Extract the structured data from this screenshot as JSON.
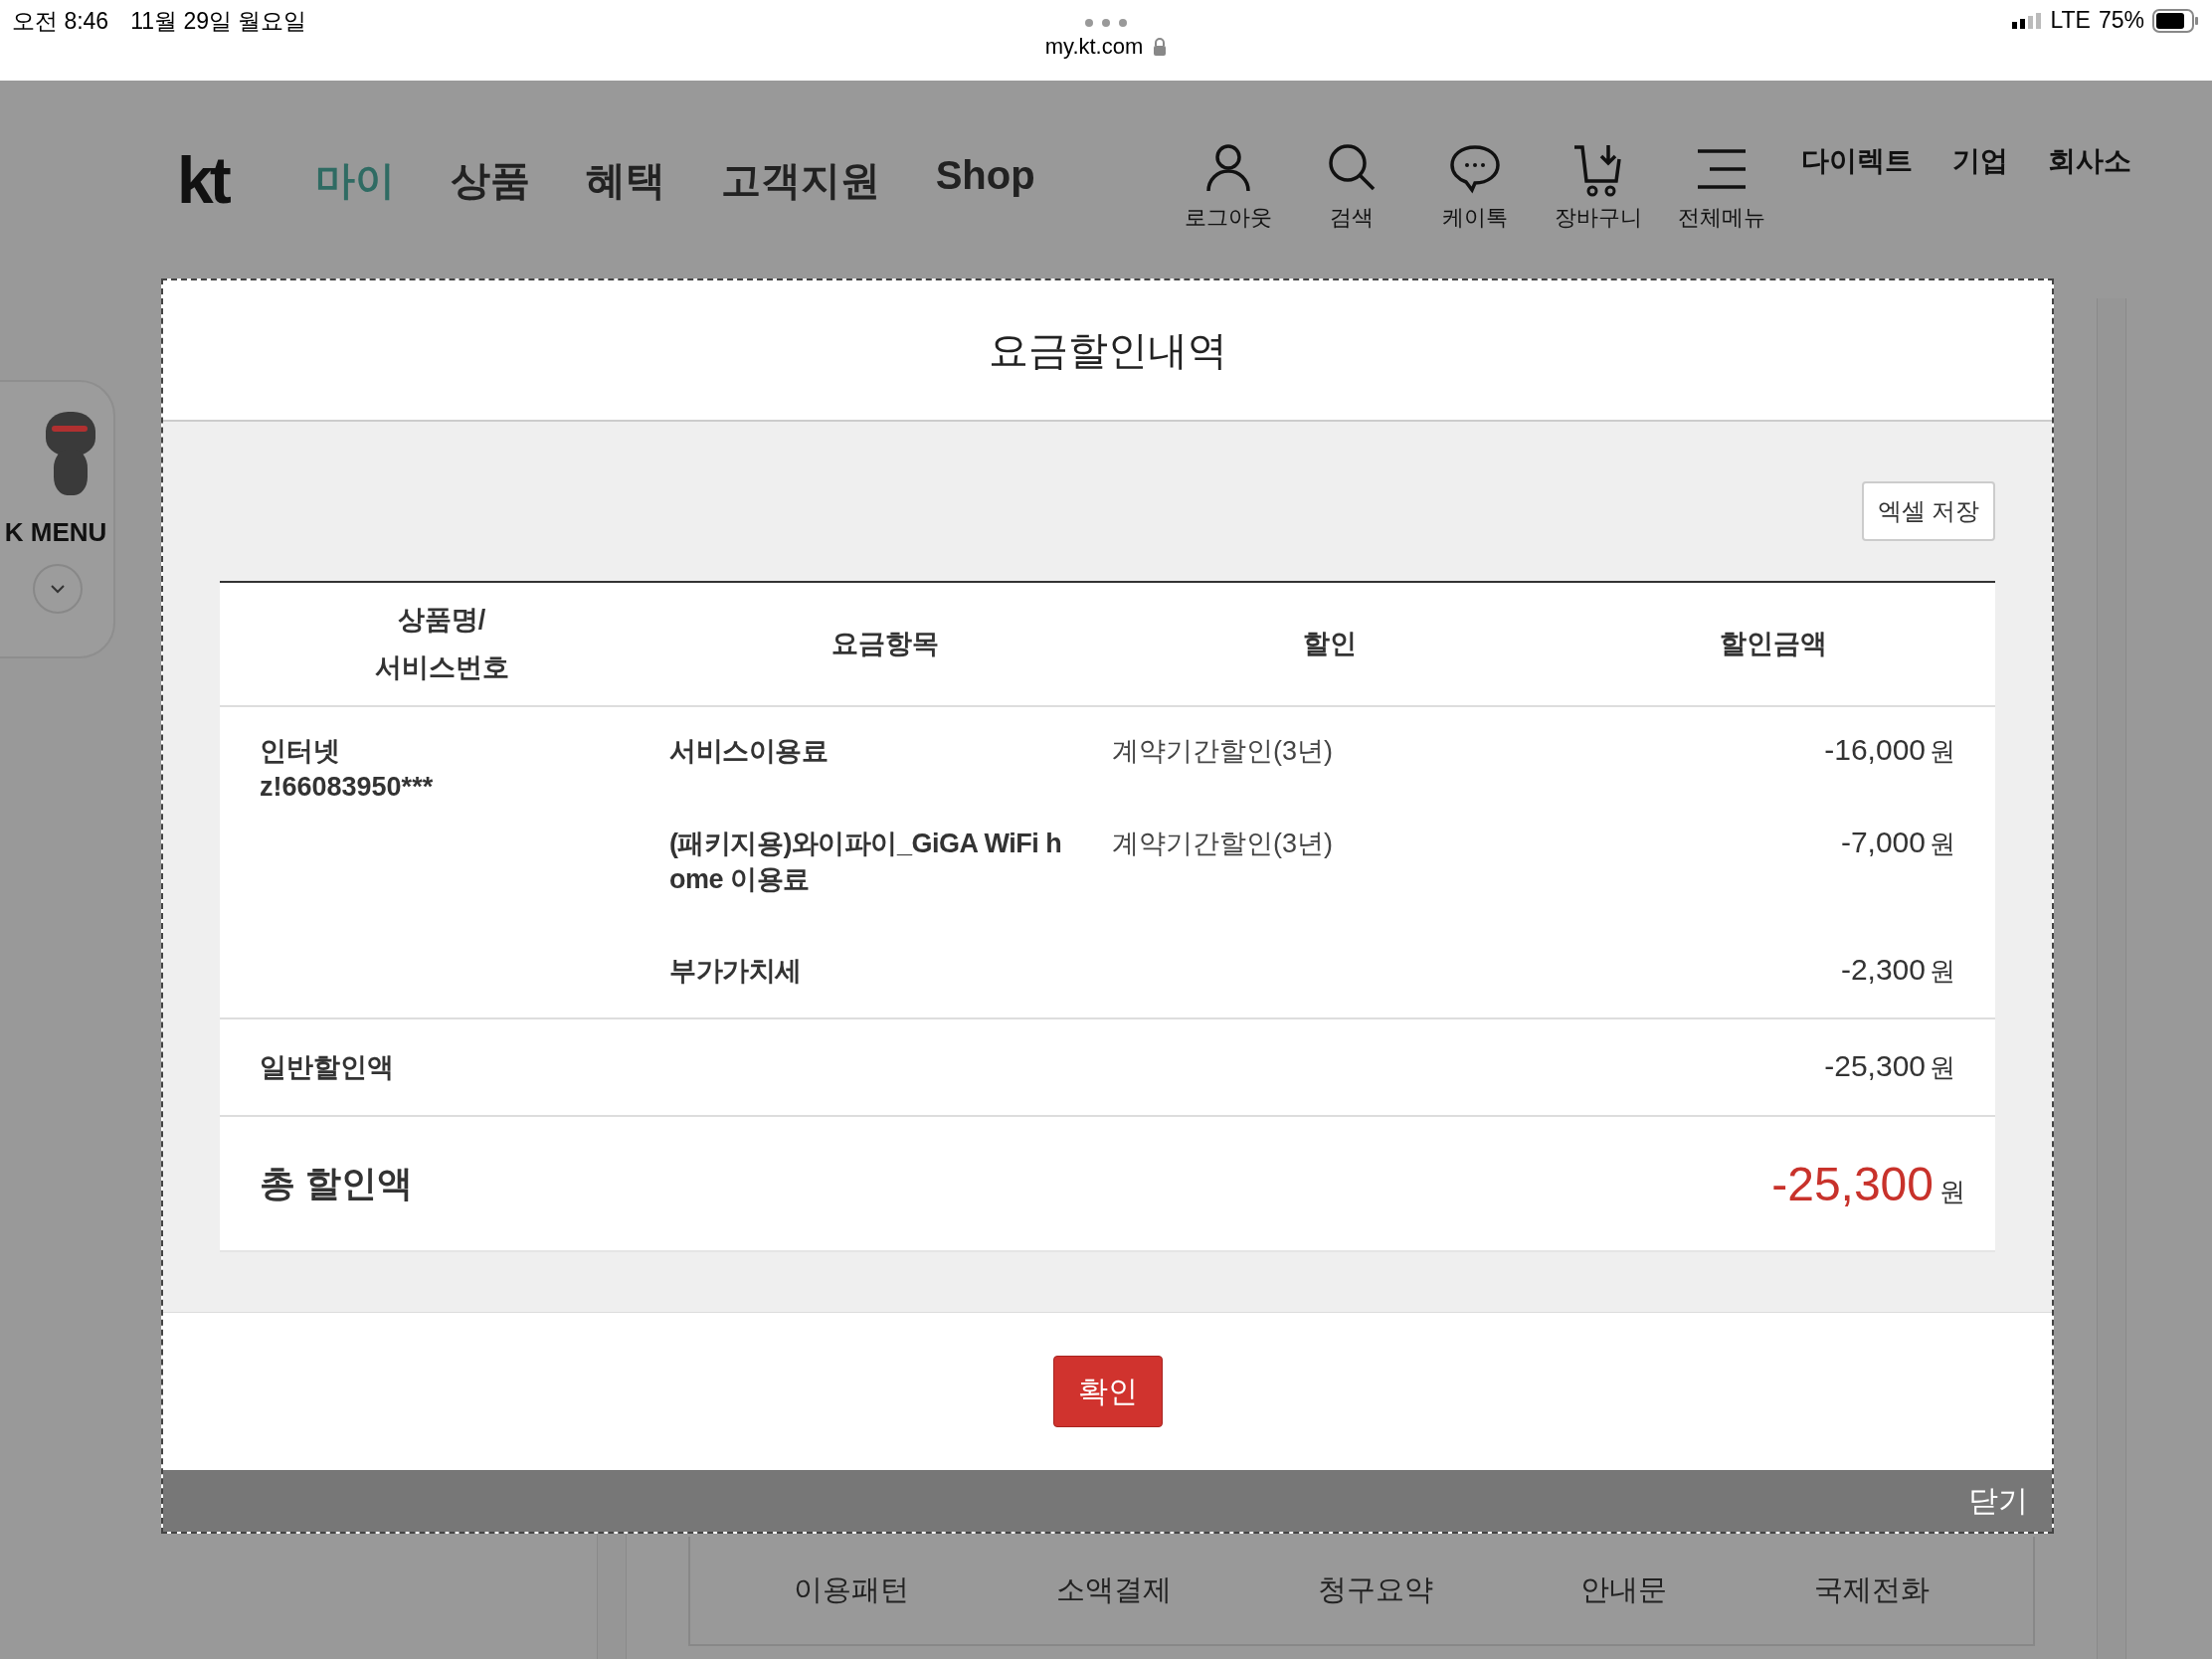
{
  "status_bar": {
    "time": "오전 8:46",
    "date": "11월 29일 월요일",
    "url": "my.kt.com",
    "network": "LTE",
    "battery": "75%"
  },
  "header": {
    "logo": "kt",
    "nav": [
      {
        "label": "마이",
        "selected": true
      },
      {
        "label": "상품",
        "selected": false
      },
      {
        "label": "혜택",
        "selected": false
      },
      {
        "label": "고객지원",
        "selected": false
      },
      {
        "label": "Shop",
        "selected": false
      }
    ],
    "icon_menu": [
      {
        "label": "로그아웃",
        "kind": "person"
      },
      {
        "label": "검색",
        "kind": "search"
      },
      {
        "label": "케이톡",
        "kind": "chat"
      },
      {
        "label": "장바구니",
        "kind": "cart"
      },
      {
        "label": "전체메뉴",
        "kind": "menu"
      }
    ],
    "links": [
      "다이렉트",
      "기업",
      "회사소"
    ]
  },
  "quick_menu": {
    "label": "K MENU"
  },
  "background_links": [
    "이용패턴",
    "소액결제",
    "청구요약",
    "안내문",
    "국제전화"
  ],
  "modal": {
    "title": "요금할인내역",
    "excel_button": "엑셀 저장",
    "columns": [
      "상품명/\n서비스번호",
      "요금항목",
      "할인",
      "할인금액"
    ],
    "groups": [
      {
        "product": "인터넷",
        "service_number": "z!66083950***",
        "items": [
          {
            "fee_item": "서비스이용료",
            "discount": "계약기간할인(3년)",
            "amount": "-16,000",
            "unit": "원"
          },
          {
            "fee_item": "(패키지용)와이파이_GiGA WiFi h\nome 이용료",
            "discount": "계약기간할인(3년)",
            "amount": "-7,000",
            "unit": "원"
          },
          {
            "fee_item": "부가가치세",
            "amount": "-2,300",
            "unit": "원"
          }
        ]
      }
    ],
    "subtotal": {
      "label": "일반할인액",
      "amount": "-25,300",
      "unit": "원"
    },
    "total": {
      "label": "총 할인액",
      "amount": "-25,300",
      "unit": "원"
    },
    "confirm_button": "확인",
    "close_button": "닫기"
  }
}
